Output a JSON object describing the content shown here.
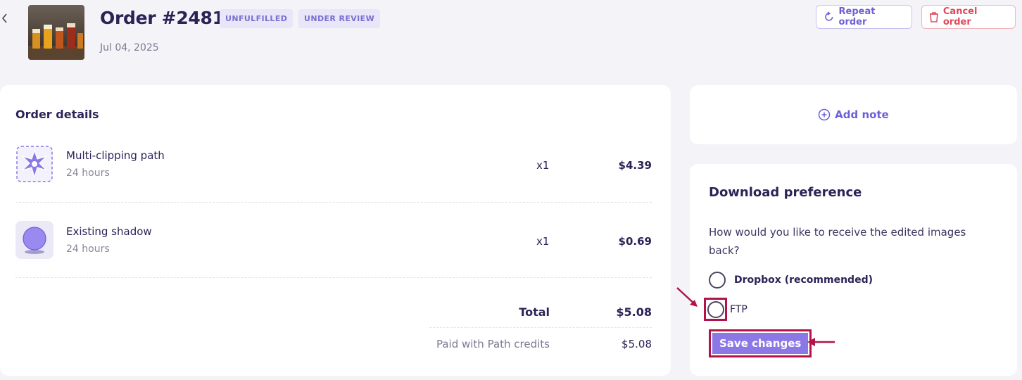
{
  "header": {
    "order_title": "Order #2481",
    "badges": [
      "UNFULFILLED",
      "UNDER REVIEW"
    ],
    "date": "Jul 04, 2025",
    "repeat_label": "Repeat order",
    "cancel_label": "Cancel order"
  },
  "order_details": {
    "title": "Order details",
    "items": [
      {
        "name": "Multi-clipping path",
        "turnaround": "24 hours",
        "qty": "x1",
        "price": "$4.39",
        "icon": "multi-clipping-path-icon"
      },
      {
        "name": "Existing shadow",
        "turnaround": "24 hours",
        "qty": "x1",
        "price": "$0.69",
        "icon": "existing-shadow-icon"
      }
    ],
    "total_label": "Total",
    "total_value": "$5.08",
    "paid_label": "Paid with Path credits",
    "paid_value": "$5.08"
  },
  "note": {
    "add_note_label": "Add note"
  },
  "download_preference": {
    "title": "Download preference",
    "question": "How would you like to receive the edited images back?",
    "options": [
      {
        "label": "Dropbox (recommended)",
        "selected": false
      },
      {
        "label": "FTP",
        "selected": false
      }
    ],
    "save_label": "Save changes"
  },
  "colors": {
    "accent": "#6d5fd8",
    "danger": "#e0475a",
    "highlight": "#b0144a",
    "save_button": "#8b78e6"
  }
}
